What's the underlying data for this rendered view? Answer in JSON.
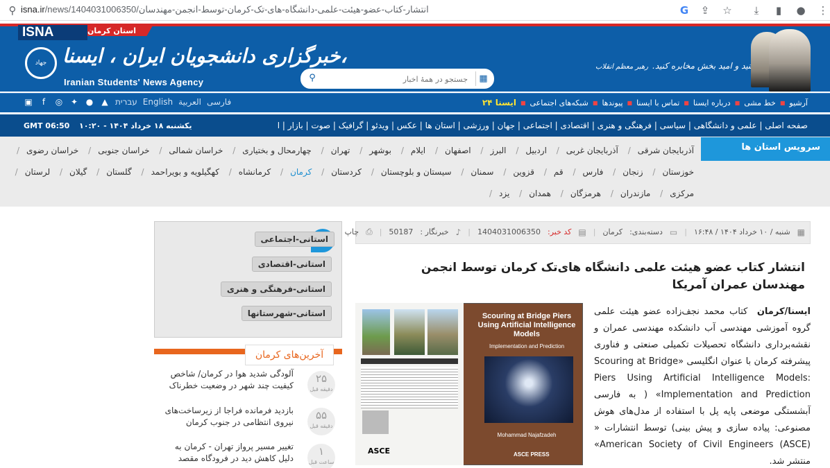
{
  "browser": {
    "url_host": "isna.ir",
    "url_path": "/news/1404031006350/انتشار-کتاب-عضو-هیئت-علمی-دانشگاه-های-تک-کرمان-توسط-انجمن-مهندسان",
    "icons": [
      "google-icon",
      "share-icon",
      "star-icon",
      "download-icon",
      "sidebar-icon",
      "profile-icon",
      "menu-icon"
    ]
  },
  "header": {
    "logo": "ISNA",
    "province": "استان کرمان",
    "jahad": "جهاد",
    "agency_fa": "خبرگزاری دانشجویان ایران ، ایسنا،",
    "agency_en": "Iranian Students' News Agency",
    "search_placeholder": "جستجو در همهٔ اخبار",
    "slogan": "اخبار خوب، منید و امید بخش مخابره کنید.",
    "slogan_sig": "رهبر معظم انقلاب"
  },
  "nav": {
    "items": [
      "آرشیو",
      "خط مشی",
      "درباره ایسنا",
      "تماس با ایسنا",
      "پیوندها",
      "شبکه‌های اجتماعی",
      "ایسنا ۲۴"
    ],
    "languages": [
      "فارسی",
      "العربية",
      "English",
      "עברית"
    ]
  },
  "catbar": {
    "categories": "صفحه اصلی | علمی و دانشگاهی | سیاسی | فرهنگی و هنری | اقتصادی | اجتماعی | جهان | ورزشی | استان ها | عکس | ویدئو | گرافیک | صوت | بازار | ایسنا+",
    "date": "یکشنبه ۱۸ خرداد ۱۴۰۴ - ۱۰:۲۰",
    "gmt": "GMT 06:50"
  },
  "provinces": {
    "title": "سرویس استان ها",
    "row1": [
      "آذربایجان شرقی",
      "آذربایجان غربی",
      "اردبیل",
      "البرز",
      "اصفهان",
      "ایلام",
      "بوشهر",
      "تهران",
      "چهارمحال و بختیاری",
      "خراسان شمالی",
      "خراسان جنوبی",
      "خراسان رضوی"
    ],
    "row2": [
      "خوزستان",
      "زنجان",
      "فارس",
      "قم",
      "قزوین",
      "سمنان",
      "سیستان و بلوچستان",
      "کردستان",
      "کرمان",
      "کرمانشاه",
      "کهگیلویه و بویراحمد",
      "گلستان",
      "گیلان",
      "لرستان"
    ],
    "row3": [
      "مرکزی",
      "مازندران",
      "هرمزگان",
      "همدان",
      "یزد"
    ],
    "active": "کرمان"
  },
  "tags": [
    "استانی-اجتماعی",
    "استانی-اقتصادی",
    "استانی-فرهنگی و هنری",
    "استانی-شهرستانها"
  ],
  "latest": {
    "title": "آخرین‌های کرمان",
    "items": [
      {
        "text": "آلودگی شدید هوا در کرمان/ شاخص کیفیت چند شهر در وضعیت خطرناک",
        "num": "۲۵",
        "unit": "دقیقه قبل"
      },
      {
        "text": "بازدید فرمانده فراجا از زیرساخت‌های نیروی انتظامی در جنوب کرمان",
        "num": "۵۵",
        "unit": "دقیقه قبل"
      },
      {
        "text": "تغییر مسیر پرواز تهران - کرمان به دلیل کاهش دید در فرودگاه مقصد",
        "num": "۱",
        "unit": "ساعت قبل"
      }
    ]
  },
  "article": {
    "date": "شنبه / ۱۰ خرداد ۱۴۰۴ / ۱۶:۴۸",
    "category_label": "دسته‌بندی:",
    "category": "کرمان",
    "code_label": "کد خبر:",
    "code": "1404031006350",
    "reporter_label": "خبرنگار :",
    "reporter": "50187",
    "print": "چاپ",
    "title": "انتشار کتاب عضو هیئت علمی دانشگاه های‌تک کرمان توسط انجمن مهندسان عمران آمریکا",
    "lead": "ایسنا/کرمان",
    "body": "کتاب محمد نجف‌زاده عضو هیئت علمی گروه آموزشی مهندسی آب دانشکده مهندسی عمران و نقشه‌برداری دانشگاه تحصیلات تکمیلی صنعتی و فناوری پیشرفته کرمان با عنوان انگلیسی «Scouring at Bridge Piers Using Artificial Intelligence Models: Implementation and Prediction» ( به فارسی آبشستگی موضعی پایه پل با استفاده از مدل‌های هوش مصنوعی: پیاده سازی و پیش بینی) توسط انتشارات « American Society of Civil Engineers (ASCE)» منتشر شد."
  },
  "book": {
    "title": "Scouring at Bridge Piers Using Artificial Intelligence Models",
    "subtitle": "Implementation and Prediction",
    "author": "Mohammad Najafzadeh",
    "publisher": "ASCE PRESS",
    "asce": "ASCE"
  }
}
